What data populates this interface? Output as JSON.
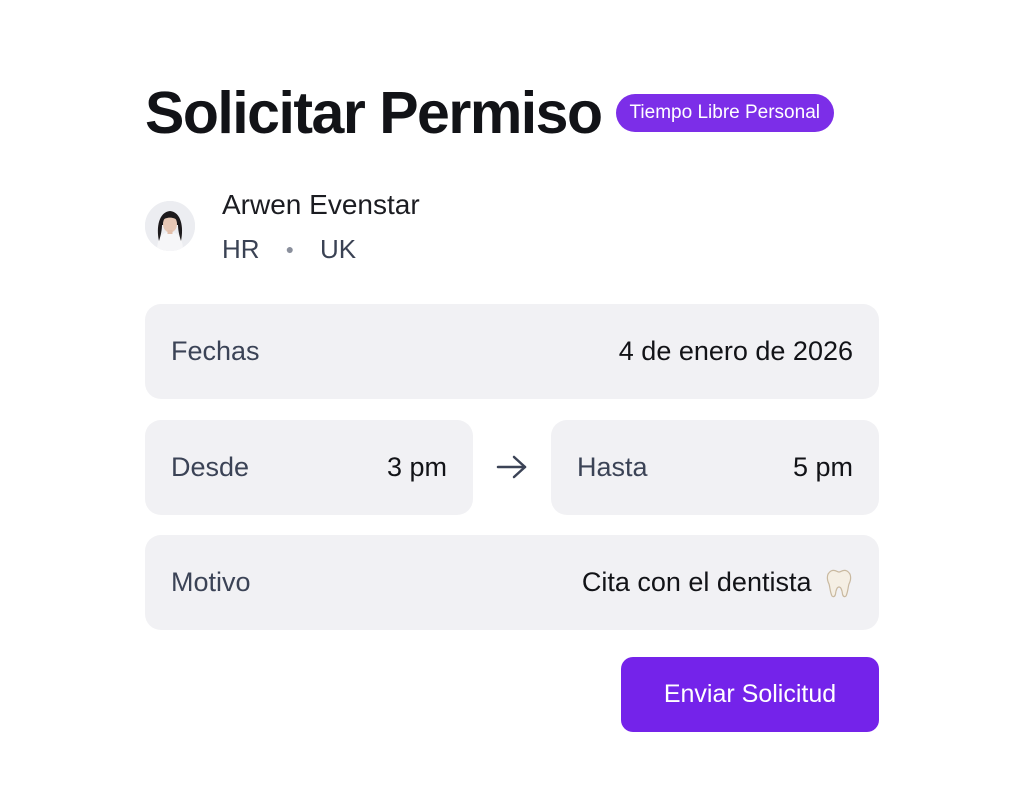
{
  "header": {
    "title": "Solicitar Permiso",
    "badge": "Tiempo Libre Personal",
    "badge_color": "#7c2ee8"
  },
  "user": {
    "name": "Arwen Evenstar",
    "department": "HR",
    "location": "UK",
    "avatar_icon": "avatar-woman-portrait"
  },
  "fields": {
    "dates": {
      "label": "Fechas",
      "value": "4 de enero de 2026"
    },
    "from": {
      "label": "Desde",
      "value": "3 pm"
    },
    "to": {
      "label": "Hasta",
      "value": "5 pm"
    },
    "reason": {
      "label": "Motivo",
      "value": "Cita con el dentista",
      "icon": "tooth-icon"
    }
  },
  "range_icon": "arrow-right-icon",
  "actions": {
    "submit_label": "Enviar Solicitud",
    "submit_color": "#7423ea"
  }
}
